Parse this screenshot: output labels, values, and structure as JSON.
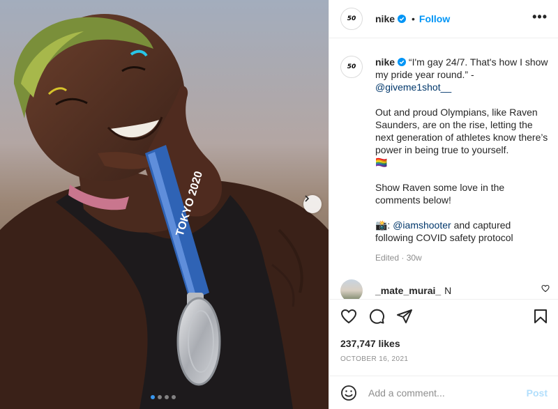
{
  "post": {
    "username": "nike",
    "avatar_text": "50",
    "follow_label": "Follow",
    "separator": "•",
    "more_label": "•••",
    "verified_color": "#0095f6",
    "accent_color": "#0095f6"
  },
  "caption": {
    "username": "nike",
    "quote": " “I'm gay 24/7. That's how I show my pride year round.” - ",
    "mention1": "@giveme1shot__",
    "paragraph2": "\n\nOut and proud Olympians, like Raven Saunders, are on the rise, letting the next generation of athletes know there’s power in being true to yourself.\n🏳️‍🌈\n\nShow Raven some love in the comments below!\n\n📸: ",
    "mention2": "@iamshooter",
    "paragraph3": " and captured following COVID safety protocol",
    "edited": "Edited · 30w"
  },
  "comment": {
    "username": "_mate_murai_",
    "text": "N"
  },
  "photo": {
    "medal_ribbon_text": "TOKYO 2020",
    "carousel_count": 4,
    "carousel_active": 1
  },
  "stats": {
    "likes": "237,747 likes",
    "date": "OCTOBER 16, 2021"
  },
  "add_comment": {
    "placeholder": "Add a comment...",
    "post_label": "Post"
  },
  "icons": {
    "heart": "heart-icon",
    "comment": "comment-icon",
    "share": "share-icon",
    "save": "bookmark-icon",
    "emoji": "emoji-icon",
    "next": "chevron-right-icon",
    "verified": "verified-badge-icon"
  }
}
